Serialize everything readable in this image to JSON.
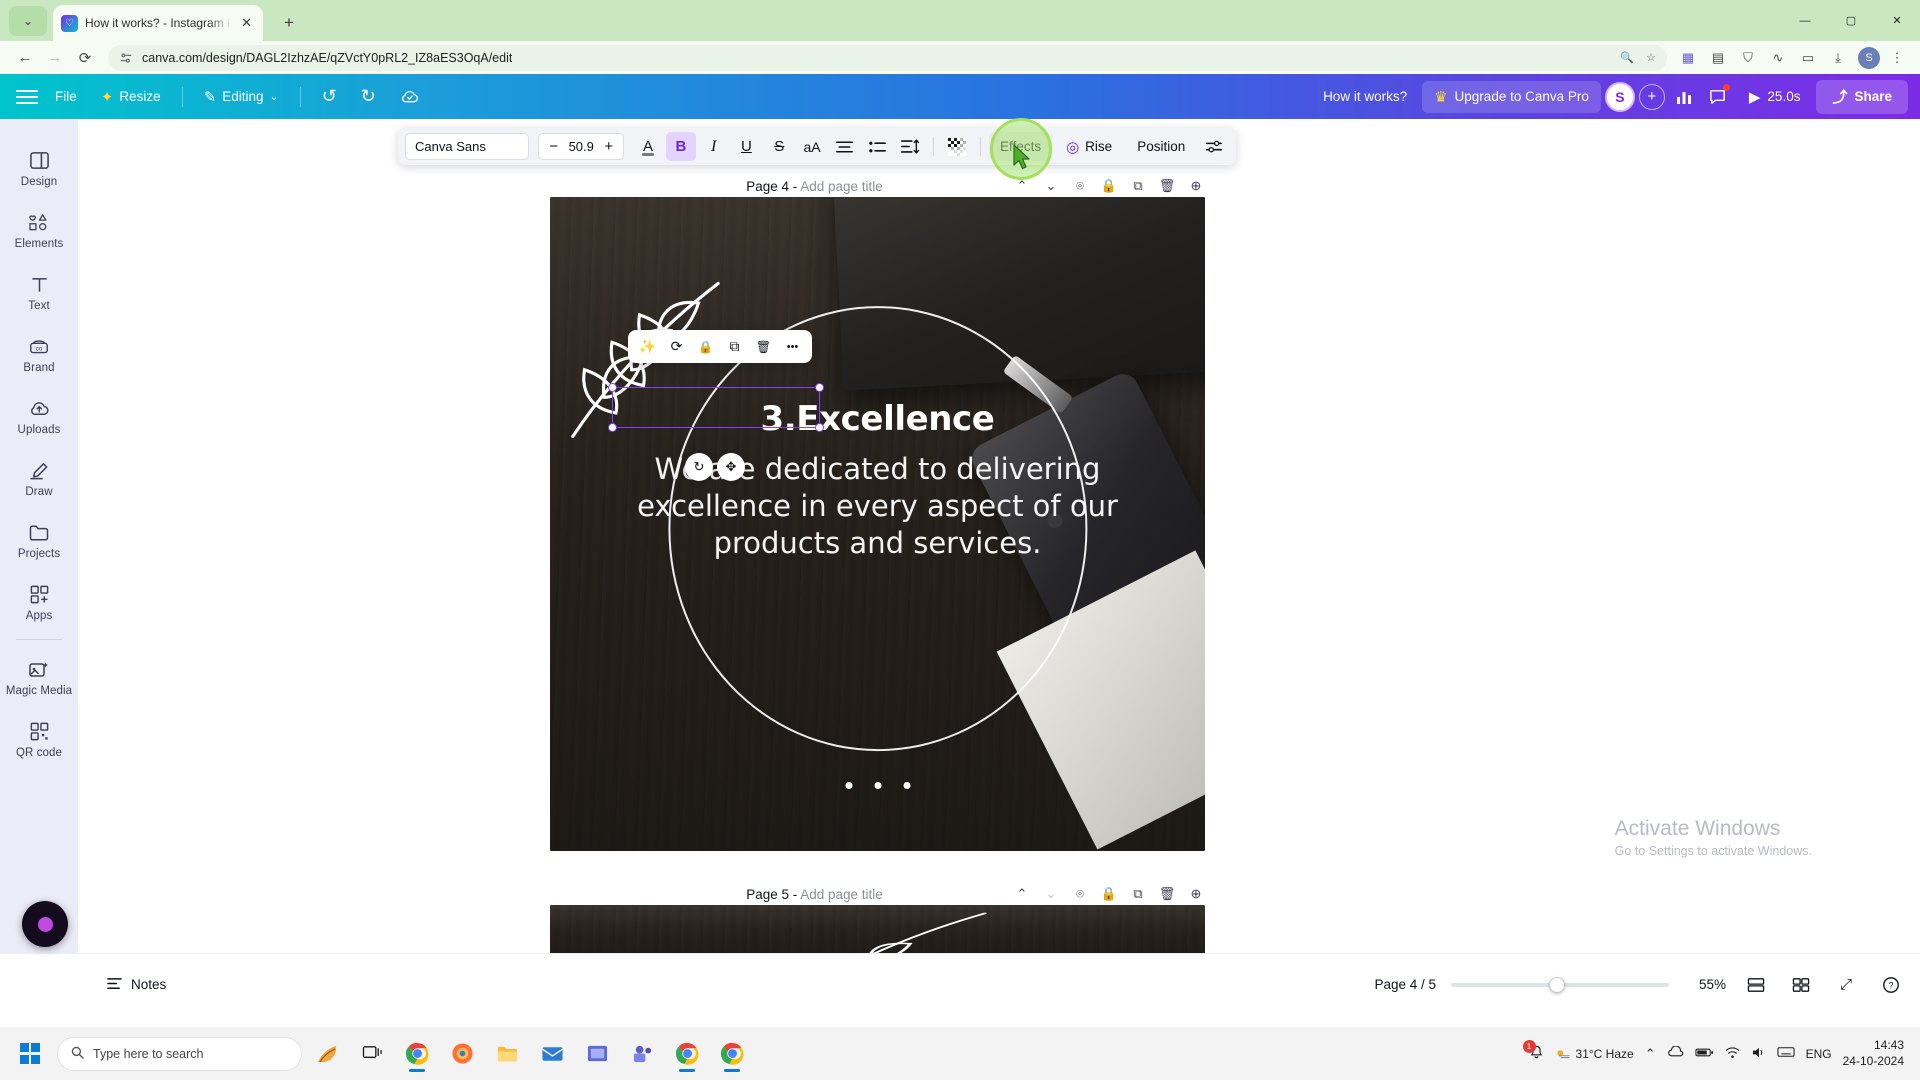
{
  "browser": {
    "tab": {
      "title": "How it works? - Instagram Post",
      "favicon": "canva-icon",
      "close": "✕"
    },
    "new_tab": "+",
    "tab_list_chevron": "⌄",
    "window_controls": {
      "minimize": "—",
      "maximize": "▢",
      "close": "✕"
    },
    "nav": {
      "back": "←",
      "forward": "→",
      "reload": "⟳"
    },
    "omnibox": {
      "site_icon": "site-settings-icon",
      "url": "canva.com/design/DAGL2IzhzAE/qZVctY0pRL2_IZ8aES3OqA/edit",
      "zoom_icon": "🔍",
      "bookmark_icon": "☆"
    },
    "extensions": [
      "puzzle-icon",
      "grid-icon",
      "shield-icon",
      "wave-icon",
      "clipboard-icon",
      "download-icon"
    ],
    "profile_initial": "S",
    "menu_icon": "⋮"
  },
  "canva_header": {
    "menu_icon": "hamburger-icon",
    "file_label": "File",
    "resize_label": "Resize",
    "resize_icon": "✦",
    "editing_label": "Editing",
    "editing_icon": "✎",
    "editing_caret": "⌄",
    "undo_icon": "↺",
    "redo_icon": "↻",
    "cloud_icon": "☁",
    "doc_title": "How it works?",
    "upgrade_label": "Upgrade to Canva Pro",
    "upgrade_icon": "♛",
    "avatar_initial": "S",
    "add_people_icon": "+",
    "analytics_icon": "▥",
    "comment_icon": "💬",
    "play_icon": "▶",
    "timer_label": "25.0s",
    "share_label": "Share",
    "share_icon": "⤴"
  },
  "sidebar": {
    "items": [
      {
        "label": "Design",
        "icon": "layout-icon"
      },
      {
        "label": "Elements",
        "icon": "shapes-icon"
      },
      {
        "label": "Text",
        "icon": "text-T-icon"
      },
      {
        "label": "Brand",
        "icon": "brand-co-icon"
      },
      {
        "label": "Uploads",
        "icon": "cloud-upload-icon"
      },
      {
        "label": "Draw",
        "icon": "pen-icon"
      },
      {
        "label": "Projects",
        "icon": "folder-icon"
      },
      {
        "label": "Apps",
        "icon": "apps-grid-plus-icon"
      },
      {
        "label": "Magic Media",
        "icon": "magic-media-icon"
      },
      {
        "label": "QR code",
        "icon": "qr-code-icon"
      }
    ]
  },
  "text_toolbar": {
    "font_family": "Canva Sans",
    "font_caret": "⌄",
    "size_minus": "−",
    "font_size": "50.9",
    "size_plus": "+",
    "text_color_icon": "A",
    "bold_label": "B",
    "italic_label": "I",
    "underline_label": "U",
    "strikethrough_label": "S",
    "case_label": "aA",
    "align_icon": "align-center-icon",
    "list_icon": "bullet-list-icon",
    "spacing_icon": "line-spacing-icon",
    "transparency_icon": "transparency-icon",
    "effects_label": "Effects",
    "animate_label": "Rise",
    "animate_icon": "◎",
    "position_label": "Position",
    "more_icon": "⌸"
  },
  "object_toolbar": {
    "items": [
      "magic-wand-icon",
      "animate-icon",
      "lock-icon",
      "duplicate-icon",
      "delete-icon",
      "more-dots-icon"
    ],
    "glyphs": [
      "✨",
      "⟳",
      "🔒",
      "⧉",
      "🗑",
      "•••"
    ],
    "rotate_icon": "↻",
    "move_icon": "✥"
  },
  "page4": {
    "header_label": "Page 4 - Add page title",
    "header_prefix": "Page 4 -",
    "header_placeholder": "Add page title",
    "icons": {
      "up": "⌃",
      "down": "⌄",
      "hide": "⌾",
      "lock": "🔒",
      "duplicate": "⧉",
      "delete": "🗑",
      "add": "⊕"
    },
    "heading": "3.Excellence",
    "body": "We are dedicated to delivering excellence in every aspect of our products and services."
  },
  "page5": {
    "header_label": "Page 5 - Add page title",
    "header_prefix": "Page 5 -",
    "header_placeholder": "Add page title"
  },
  "bottom_bar": {
    "notes_label": "Notes",
    "notes_icon": "notes-icon",
    "page_indicator": "Page 4 / 5",
    "zoom_percent": "55%",
    "grid_icon": "▤",
    "pages_icon": "▦",
    "expand_icon": "⤢",
    "help_icon": "?"
  },
  "watermark": {
    "line1": "Activate Windows",
    "line2": "Go to Settings to activate Windows."
  },
  "taskbar": {
    "search_placeholder": "Type here to search",
    "search_icon": "🔍",
    "apps": [
      "task-view-icon",
      "leaf-app-icon",
      "chrome-icon",
      "firefox-icon",
      "explorer-icon",
      "mail-icon",
      "store-icon",
      "teams-icon",
      "chrome-window-icon",
      "chrome-window-2-icon"
    ],
    "tray": {
      "weather": "31°C  Haze",
      "up_arrow": "⌃",
      "icons": [
        "onedrive-icon",
        "battery-icon",
        "network-icon",
        "volume-icon",
        "keyboard-icon"
      ],
      "language": "ENG",
      "time": "14:43",
      "date": "24-10-2024",
      "notification_icon": "🔔"
    }
  },
  "colors": {
    "accent_purple": "#8b3dff",
    "header_gradient_start": "#00c4cc",
    "header_gradient_end": "#7d2ae8",
    "cursor_green": "#a3e05d",
    "tab_strip": "#c9e7c0"
  }
}
